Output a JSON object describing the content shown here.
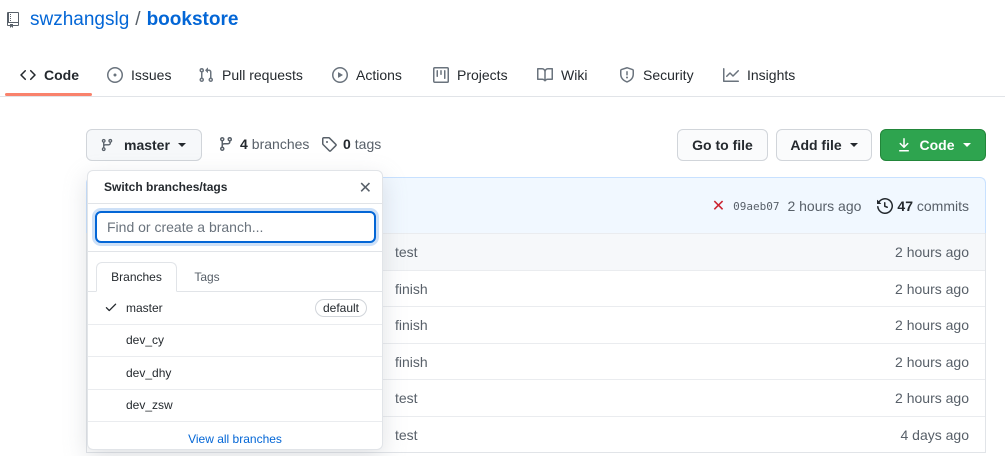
{
  "repo": {
    "owner": "swzhangslg",
    "separator": "/",
    "name": "bookstore"
  },
  "nav": {
    "tabs": [
      {
        "label": "Code",
        "icon": "code-icon",
        "selected": true
      },
      {
        "label": "Issues",
        "icon": "issue-icon"
      },
      {
        "label": "Pull requests",
        "icon": "pull-request-icon"
      },
      {
        "label": "Actions",
        "icon": "play-icon"
      },
      {
        "label": "Projects",
        "icon": "project-icon"
      },
      {
        "label": "Wiki",
        "icon": "book-icon"
      },
      {
        "label": "Security",
        "icon": "shield-icon"
      },
      {
        "label": "Insights",
        "icon": "graph-icon"
      }
    ]
  },
  "toolbar": {
    "branch": "master",
    "branches_count": "4",
    "branches_label": "branches",
    "tags_count": "0",
    "tags_label": "tags",
    "go_to_file": "Go to file",
    "add_file": "Add file",
    "code": "Code"
  },
  "commit": {
    "status": "✕",
    "sha": "09aeb07",
    "time": "2 hours ago",
    "count": "47",
    "count_label": "commits"
  },
  "files": [
    {
      "message": "test",
      "age": "2 hours ago"
    },
    {
      "message": "finish",
      "age": "2 hours ago"
    },
    {
      "message": "finish",
      "age": "2 hours ago"
    },
    {
      "message": "finish",
      "age": "2 hours ago"
    },
    {
      "message": "test",
      "age": "2 hours ago"
    },
    {
      "message": "test",
      "age": "4 days ago"
    }
  ],
  "dropdown": {
    "title": "Switch branches/tags",
    "close": "✕",
    "search_placeholder": "Find or create a branch...",
    "tabs": {
      "branches": "Branches",
      "tags": "Tags"
    },
    "branches": [
      {
        "name": "master",
        "checked": true,
        "badge": "default"
      },
      {
        "name": "dev_cy"
      },
      {
        "name": "dev_dhy"
      },
      {
        "name": "dev_zsw"
      }
    ],
    "footer": "View all branches"
  },
  "colors": {
    "link": "#0366d6",
    "green": "#2ea44f",
    "tab_accent": "#f9826c",
    "error": "#cb2431"
  }
}
